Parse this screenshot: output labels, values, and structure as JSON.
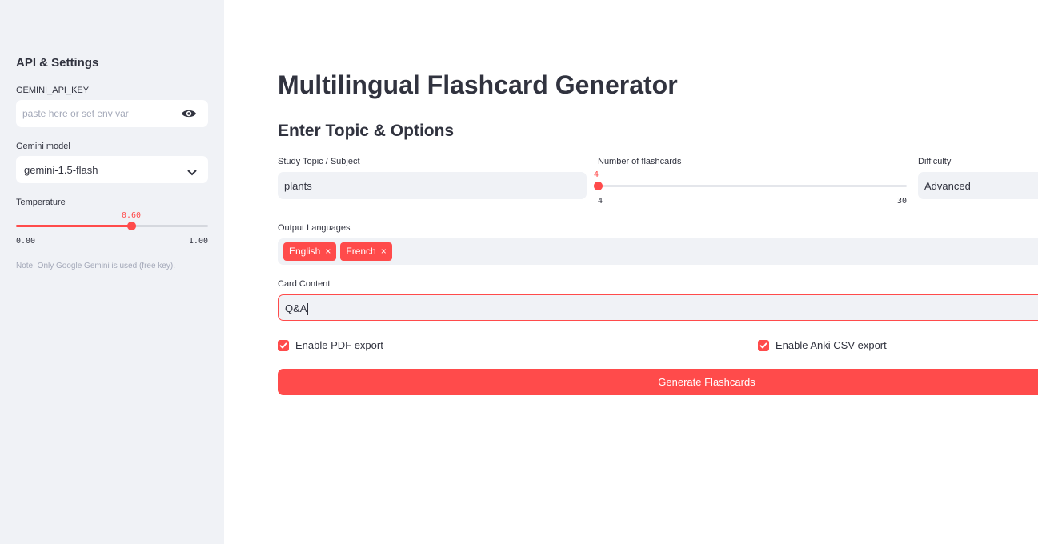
{
  "sidebar": {
    "title": "API & Settings",
    "api_key": {
      "label": "GEMINI_API_KEY",
      "placeholder": "paste here or set env var",
      "value": ""
    },
    "model": {
      "label": "Gemini model",
      "value": "gemini-1.5-flash"
    },
    "temperature": {
      "label": "Temperature",
      "value": "0.60",
      "min": "0.00",
      "max": "1.00",
      "fraction": 0.6
    },
    "note": "Note: Only Google Gemini is used (free key)."
  },
  "main": {
    "title": "Multilingual Flashcard Generator",
    "section_title": "Enter Topic & Options",
    "topic": {
      "label": "Study Topic / Subject",
      "value": "plants"
    },
    "num_cards": {
      "label": "Number of flashcards",
      "value": "4",
      "min": "4",
      "max": "30"
    },
    "difficulty": {
      "label": "Difficulty",
      "value": "Advanced"
    },
    "languages": {
      "label": "Output Languages",
      "tags": [
        "English",
        "French"
      ]
    },
    "card_content": {
      "label": "Card Content",
      "value": "Q&A"
    },
    "pdf_export": {
      "label": "Enable PDF export",
      "checked": true
    },
    "anki_export": {
      "label": "Enable Anki CSV export",
      "checked": true
    },
    "generate_button": "Generate Flashcards"
  },
  "colors": {
    "accent": "#ff4b4b",
    "sidebar_bg": "#f0f2f6",
    "text": "#31333f"
  },
  "icons": {
    "reveal": "eye-icon",
    "dropdown": "chevron-down-icon",
    "check": "check-icon",
    "remove_tag": "x-icon"
  }
}
